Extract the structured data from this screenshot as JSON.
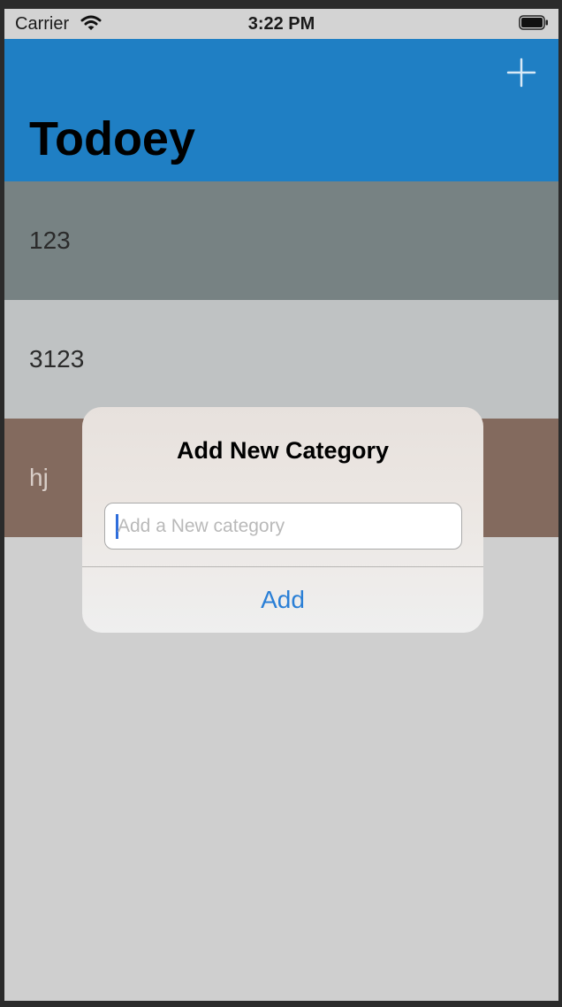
{
  "status_bar": {
    "carrier": "Carrier",
    "time": "3:22 PM",
    "wifi_icon": "wifi-icon",
    "battery_icon": "battery-icon"
  },
  "nav_bar": {
    "title": "Todoey",
    "add_icon": "plus-icon",
    "background_color": "#1f7fc4"
  },
  "categories": [
    {
      "name": "123",
      "background_color": "#778283",
      "text_color": "#2b2b2b"
    },
    {
      "name": "3123",
      "background_color": "#bfc2c3",
      "text_color": "#2b2b2b"
    },
    {
      "name": "hj",
      "background_color": "#836a5e",
      "text_color": "#d8cdc7"
    }
  ],
  "dialog": {
    "title": "Add New Category",
    "input_value": "",
    "input_placeholder": "Add a New category",
    "add_label": "Add",
    "accent_color": "#2a7fd6"
  }
}
